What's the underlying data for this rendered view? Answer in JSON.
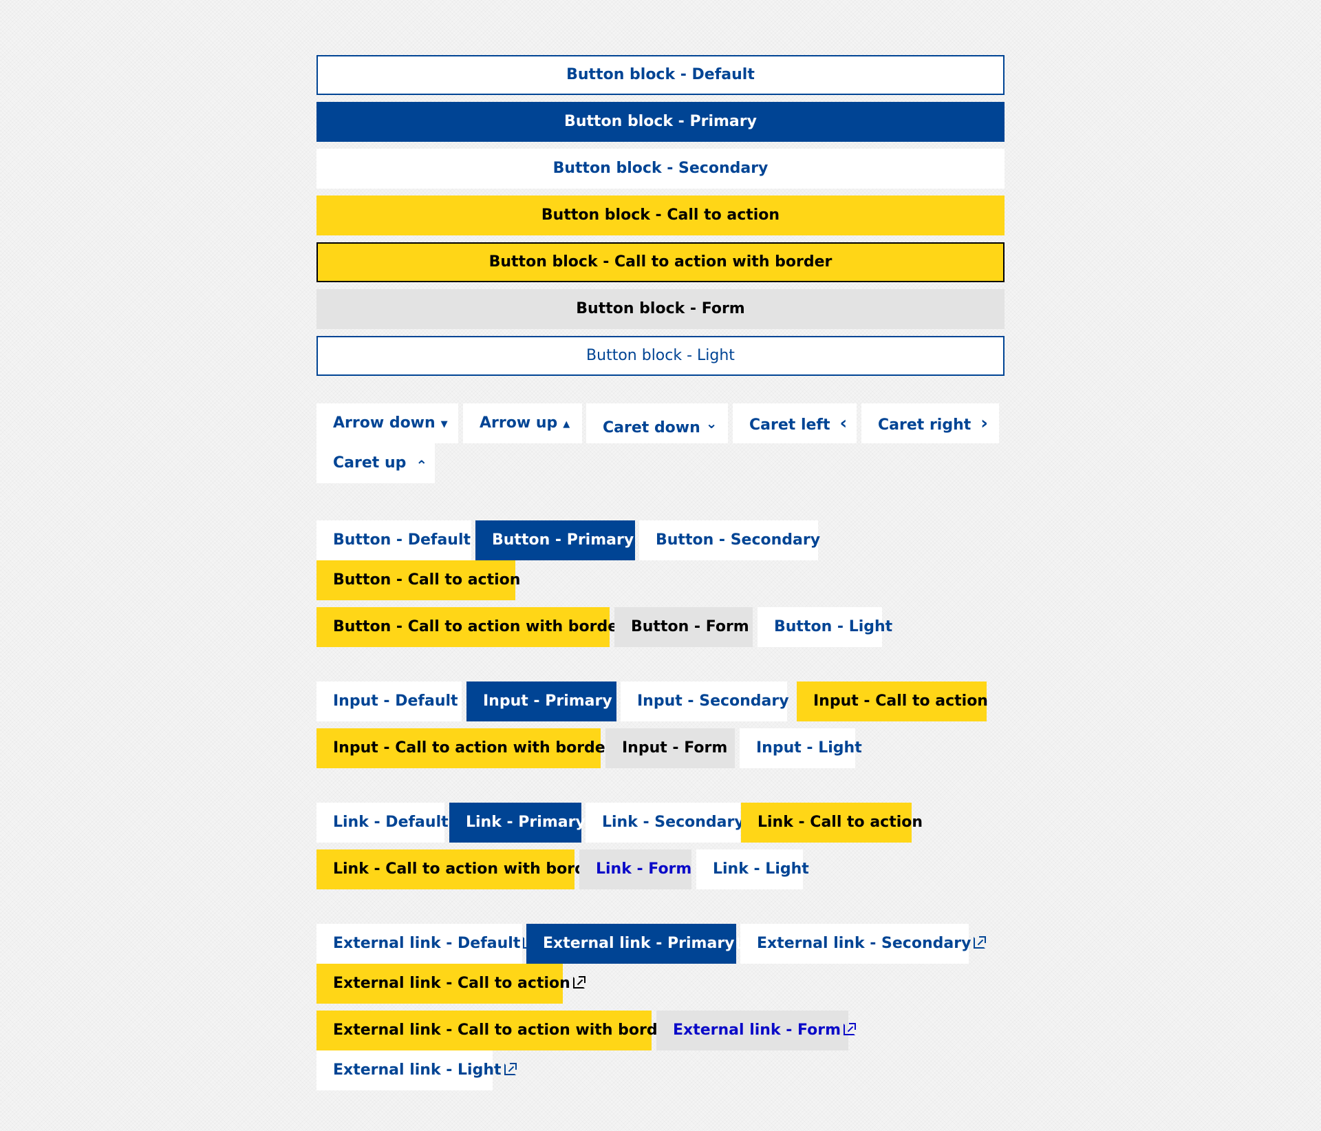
{
  "blocks": [
    {
      "variant": "default",
      "label": "Button block - Default"
    },
    {
      "variant": "primary",
      "label": "Button block - Primary"
    },
    {
      "variant": "secondary",
      "label": "Button block - Secondary"
    },
    {
      "variant": "cta",
      "label": "Button block - Call to action"
    },
    {
      "variant": "cta-border",
      "label": "Button block - Call to action with border"
    },
    {
      "variant": "form",
      "label": "Button block - Form"
    },
    {
      "variant": "light",
      "label": "Button block - Light"
    }
  ],
  "icon_buttons": [
    {
      "label": "Arrow down",
      "icon": "arrow-down-icon",
      "glyph": "▼"
    },
    {
      "label": "Arrow up",
      "icon": "arrow-up-icon",
      "glyph": "▲"
    },
    {
      "label": "Caret down",
      "icon": "caret-down-icon",
      "glyph": "⌄"
    },
    {
      "label": "Caret left",
      "icon": "caret-left-icon",
      "glyph": "‹"
    },
    {
      "label": "Caret right",
      "icon": "caret-right-icon",
      "glyph": "›"
    },
    {
      "label": "Caret up",
      "icon": "caret-up-icon",
      "glyph": "⌃"
    }
  ],
  "buttons": [
    "Button - Default",
    "Button - Primary",
    "Button - Secondary",
    "Button - Call to action",
    "Button - Call to action with border",
    "Button - Form",
    "Button - Light"
  ],
  "inputs": [
    "Input - Default",
    "Input - Primary",
    "Input - Secondary",
    "Input - Call to action",
    "Input - Call to action with border",
    "Input - Form",
    "Input - Light"
  ],
  "links": [
    "Link - Default",
    "Link - Primary",
    "Link - Secondary",
    "Link - Call to action",
    "Link - Call to action with border",
    "Link - Form",
    "Link - Light"
  ],
  "external_links": [
    "External link - Default",
    "External link - Primary",
    "External link - Secondary",
    "External link - Call to action",
    "External link - Call to action with border",
    "External link - Form",
    "External link - Light"
  ],
  "external_icon": "external-link-icon",
  "colors": {
    "primary": "#004494",
    "cta": "#ffd617",
    "form": "#e3e3e3",
    "link_form": "#0a0ac8"
  }
}
